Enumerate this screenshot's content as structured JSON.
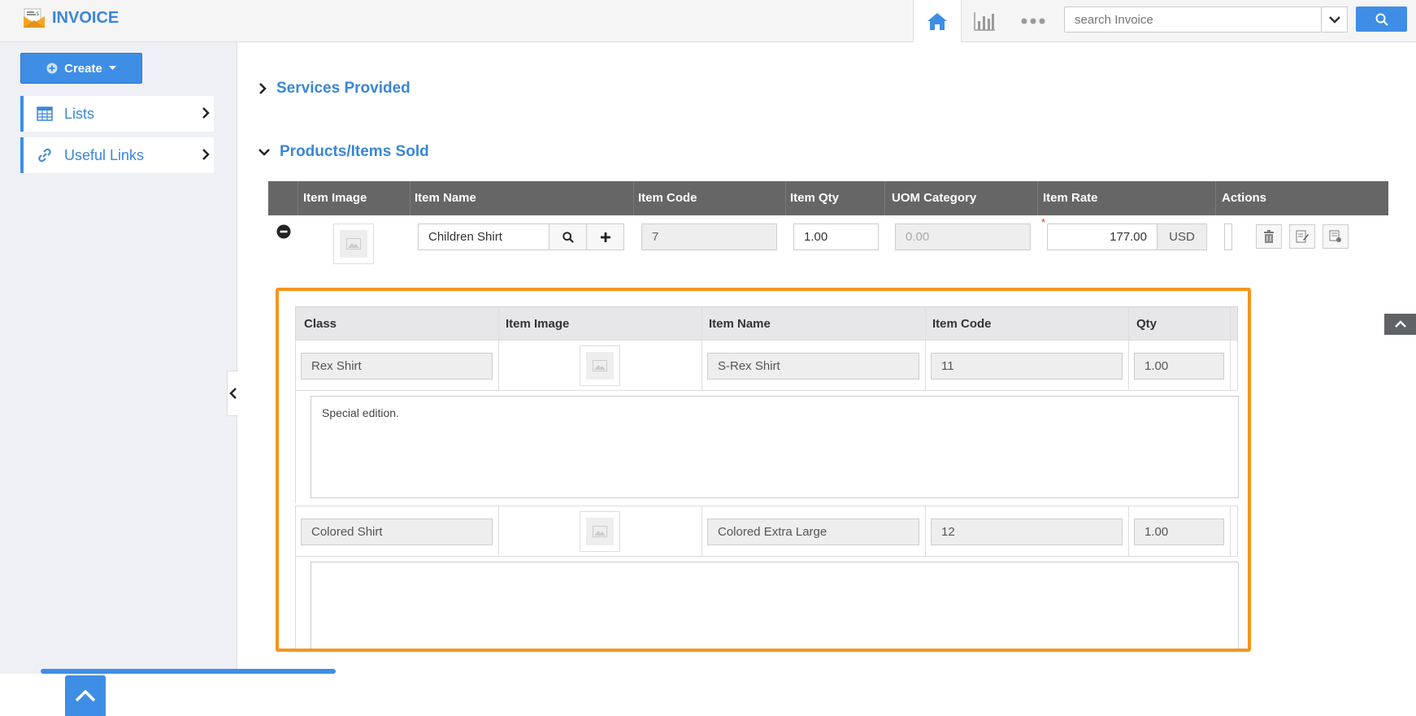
{
  "app": {
    "title": "INVOICE"
  },
  "header": {
    "search_placeholder": "search Invoice"
  },
  "sidebar": {
    "create_label": "Create",
    "items": [
      {
        "label": "Lists",
        "icon": "table-icon"
      },
      {
        "label": "Useful Links",
        "icon": "link-icon"
      }
    ]
  },
  "sections": {
    "services": "Services Provided",
    "products": "Products/Items Sold"
  },
  "grid": {
    "columns": [
      "Item Image",
      "Item Name",
      "Item Code",
      "Item Qty",
      "UOM Category",
      "Item Rate",
      "Actions"
    ],
    "row": {
      "item_name": "Children Shirt",
      "item_code": "7",
      "item_qty": "1.00",
      "uom_placeholder": "0.00",
      "item_rate": "177.00",
      "currency": "USD",
      "required_mark": "*"
    }
  },
  "sub_table": {
    "columns": [
      "Class",
      "Item Image",
      "Item Name",
      "Item Code",
      "Qty"
    ],
    "rows": [
      {
        "class": "Rex Shirt",
        "item_name": "S-Rex Shirt",
        "item_code": "11",
        "qty": "1.00",
        "notes": "Special edition."
      },
      {
        "class": "Colored Shirt",
        "item_name": "Colored Extra Large",
        "item_code": "12",
        "qty": "1.00",
        "notes": ""
      }
    ]
  },
  "colors": {
    "accent": "#3e8ee6",
    "highlight": "#f7941d",
    "grid_header": "#666666"
  }
}
